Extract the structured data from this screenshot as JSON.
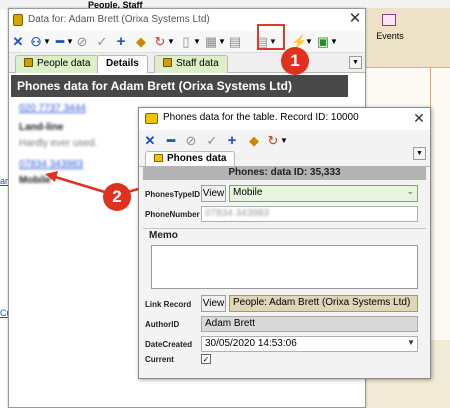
{
  "background": {
    "header_text": "People, Staff",
    "events_label": "Events",
    "link_partial_a": "ard",
    "link_partial_b": "Cu"
  },
  "details_window": {
    "title": "Data for: Adam Brett (Orixa Systems Ltd)",
    "close": "✕",
    "tabs": [
      {
        "label": "People data"
      },
      {
        "label": "Details"
      },
      {
        "label": "Staff data"
      }
    ],
    "heading": "Phones data for Adam Brett (Orixa Systems Ltd)",
    "lines": [
      "020 7737 3444",
      "Land-line",
      "Hardly ever used.",
      "07834 343983",
      "Mobile"
    ]
  },
  "annotations": {
    "badge_1": "1",
    "badge_2": "2",
    "colors": {
      "badge": "#e0301e",
      "highlight": "#e03a2a"
    }
  },
  "phones_window": {
    "title": "Phones data for the  table. Record ID: 10000",
    "close": "✕",
    "tab": "Phones data",
    "header": "Phones: data ID: 35,333",
    "fields": {
      "phones_type_id": {
        "label": "PhonesTypeID",
        "button": "View",
        "value": "Mobile"
      },
      "phone_number": {
        "label": "PhoneNumber",
        "value": "07834 343983"
      },
      "memo": {
        "label": "Memo",
        "value": ""
      },
      "link_record": {
        "label": "Link Record",
        "button": "View",
        "value": "People: Adam Brett (Orixa Systems Ltd)"
      },
      "author_id": {
        "label": "AuthorID",
        "value": "Adam Brett"
      },
      "date_created": {
        "label": "DateCreated",
        "value": "30/05/2020 14:53:06"
      },
      "current": {
        "label": "Current",
        "value": "✓"
      }
    }
  }
}
